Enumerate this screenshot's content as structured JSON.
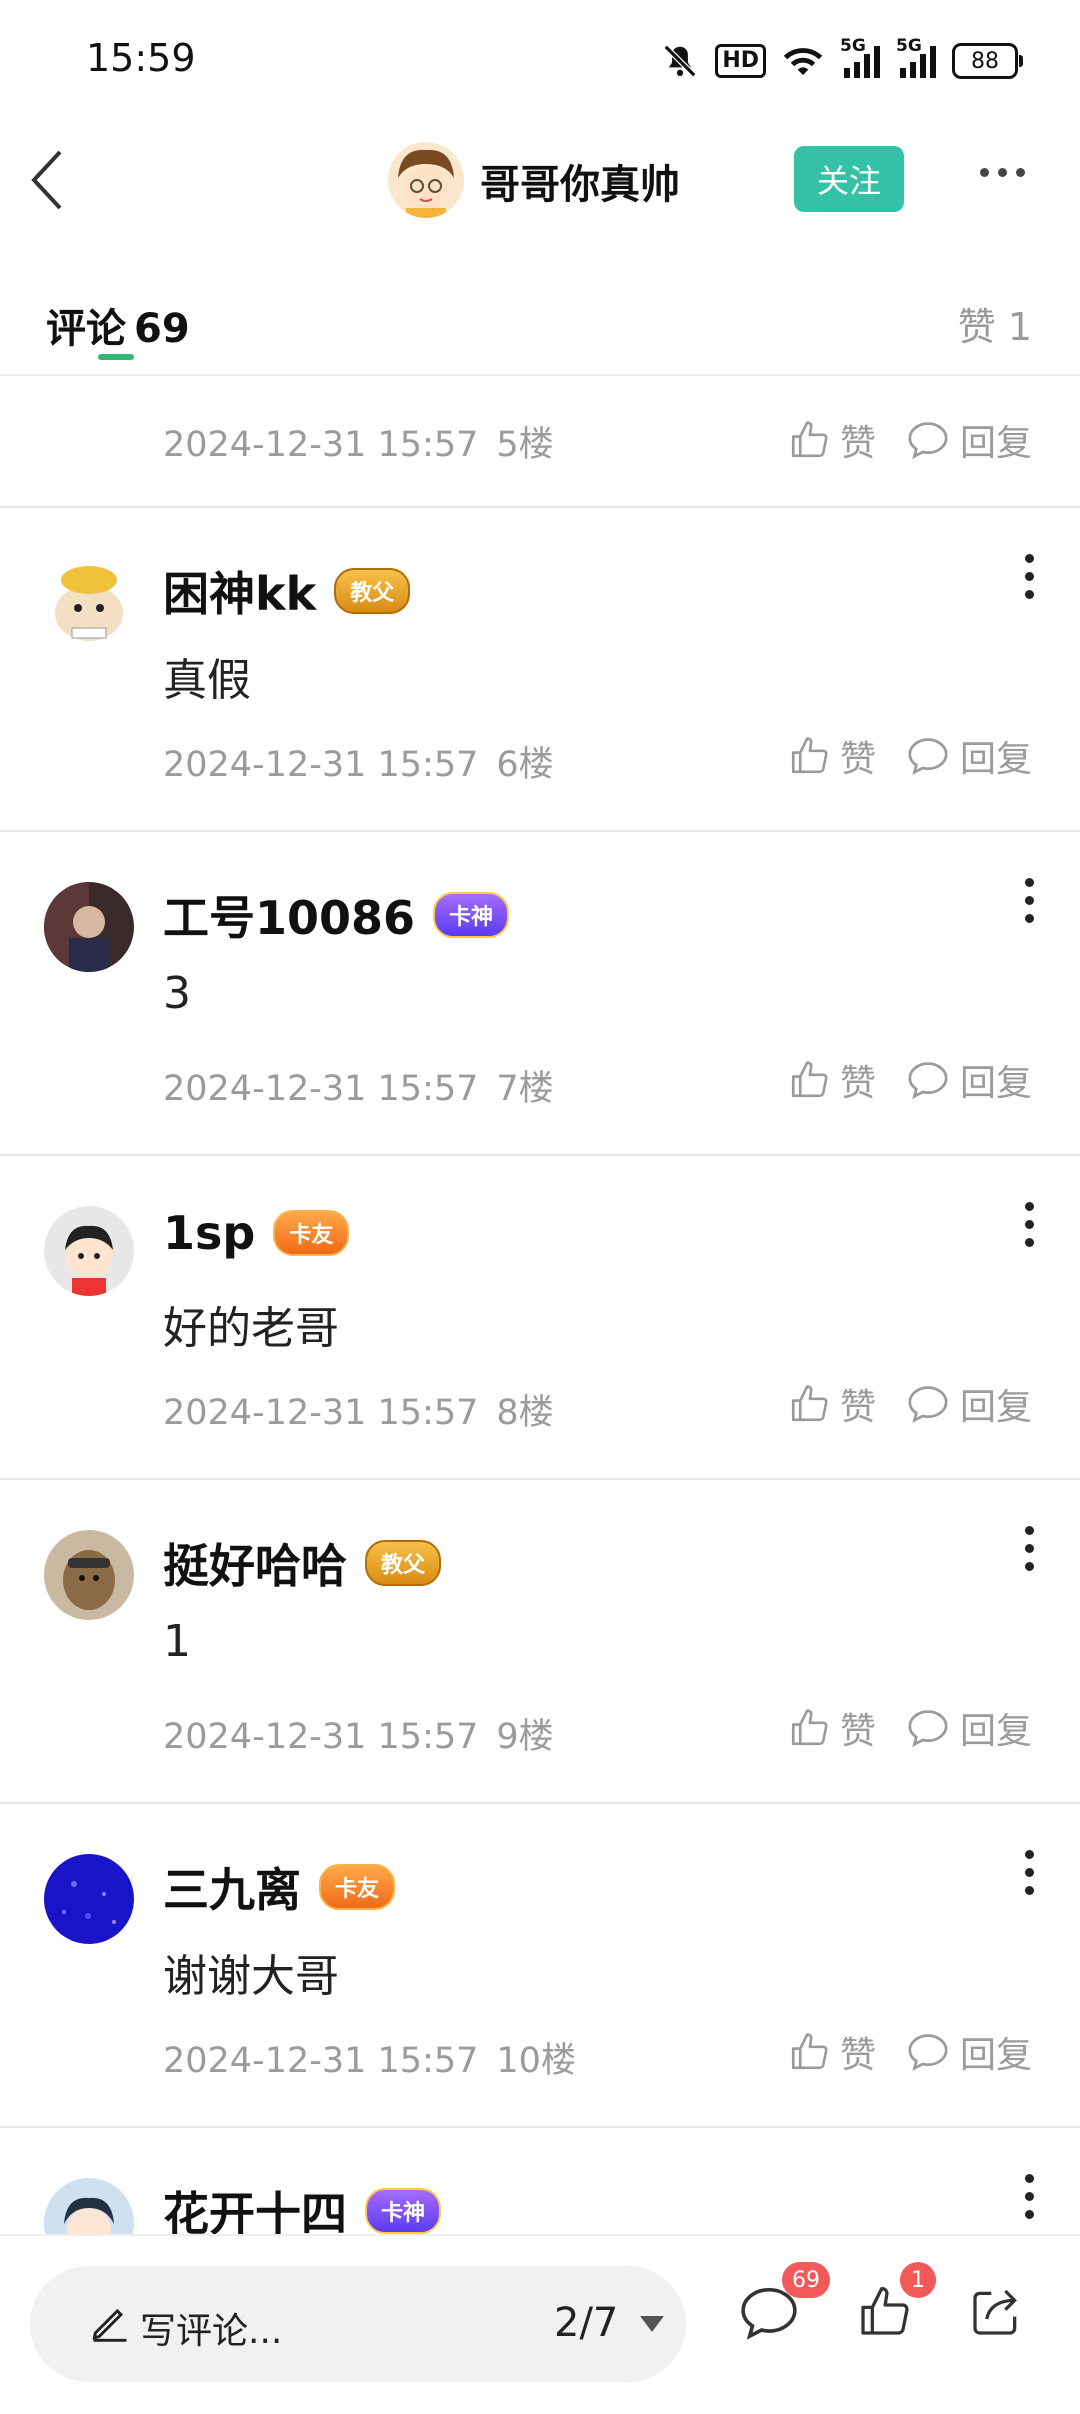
{
  "status_bar": {
    "time": "15:59",
    "hd_label": "HD",
    "signal_labels": [
      "5G",
      "5G"
    ],
    "battery": "88"
  },
  "header": {
    "title": "哥哥你真帅",
    "follow_label": "关注"
  },
  "tabs": {
    "comments_label": "评论",
    "comments_count": "69",
    "likes_label": "赞 1"
  },
  "comments": [
    {
      "name": "",
      "badge": "",
      "text": "",
      "time": "2024-12-31 15:57",
      "floor": "5楼"
    },
    {
      "name": "困神kk",
      "badge": "教父",
      "badge_style": "gold",
      "text": "真假",
      "time": "2024-12-31 15:57",
      "floor": "6楼"
    },
    {
      "name": "工号10086",
      "badge": "卡神",
      "badge_style": "purple",
      "text": "3",
      "time": "2024-12-31 15:57",
      "floor": "7楼"
    },
    {
      "name": "1sp",
      "badge": "卡友",
      "badge_style": "orange",
      "text": "好的老哥",
      "time": "2024-12-31 15:57",
      "floor": "8楼"
    },
    {
      "name": "挺好哈哈",
      "badge": "教父",
      "badge_style": "gold",
      "text": "1",
      "time": "2024-12-31 15:57",
      "floor": "9楼"
    },
    {
      "name": "三九离",
      "badge": "卡友",
      "badge_style": "orange",
      "text": "谢谢大哥",
      "time": "2024-12-31 15:57",
      "floor": "10楼"
    },
    {
      "name": "花开十四",
      "badge": "卡神",
      "badge_style": "purple",
      "text": "",
      "time": "",
      "floor": ""
    }
  ],
  "actions": {
    "like_label": "赞",
    "reply_label": "回复"
  },
  "bottom_bar": {
    "write_placeholder": "写评论...",
    "page_indicator": "2/7",
    "comment_count": "69",
    "like_count": "1"
  },
  "colors": {
    "accent_green": "#33c2a6",
    "tab_indicator": "#35b576",
    "badge_red": "#f25a5a"
  }
}
